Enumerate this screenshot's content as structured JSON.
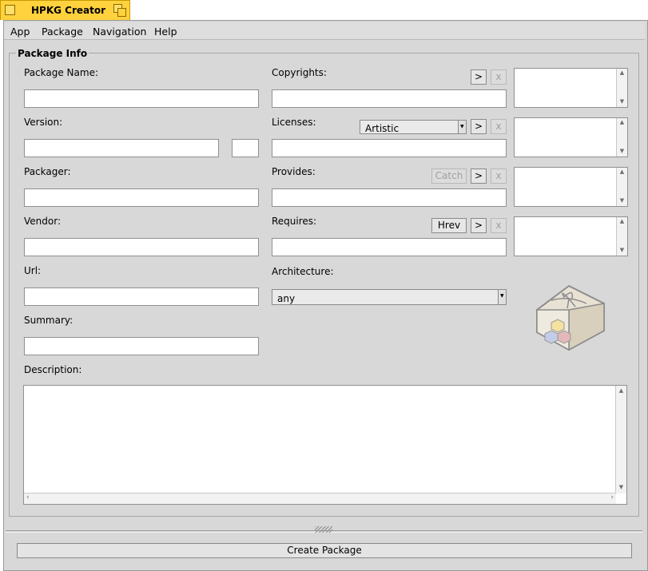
{
  "window": {
    "title": "HPKG Creator"
  },
  "menubar": {
    "items": [
      "App",
      "Package",
      "Navigation",
      "Help"
    ]
  },
  "group": {
    "title": "Package Info"
  },
  "labels": {
    "package_name": "Package Name:",
    "version": "Version:",
    "packager": "Packager:",
    "vendor": "Vendor:",
    "url": "Url:",
    "summary": "Summary:",
    "description": "Description:",
    "copyrights": "Copyrights:",
    "licenses": "Licenses:",
    "provides": "Provides:",
    "requires": "Requires:",
    "architecture": "Architecture:"
  },
  "buttons": {
    "add": ">",
    "remove": "x",
    "catch": "Catch",
    "hrev": "Hrev",
    "create_package": "Create Package"
  },
  "licenses_select": {
    "value": "Artistic"
  },
  "architecture_select": {
    "value": "any"
  },
  "icons": {
    "package": "package-bundle-icon"
  }
}
